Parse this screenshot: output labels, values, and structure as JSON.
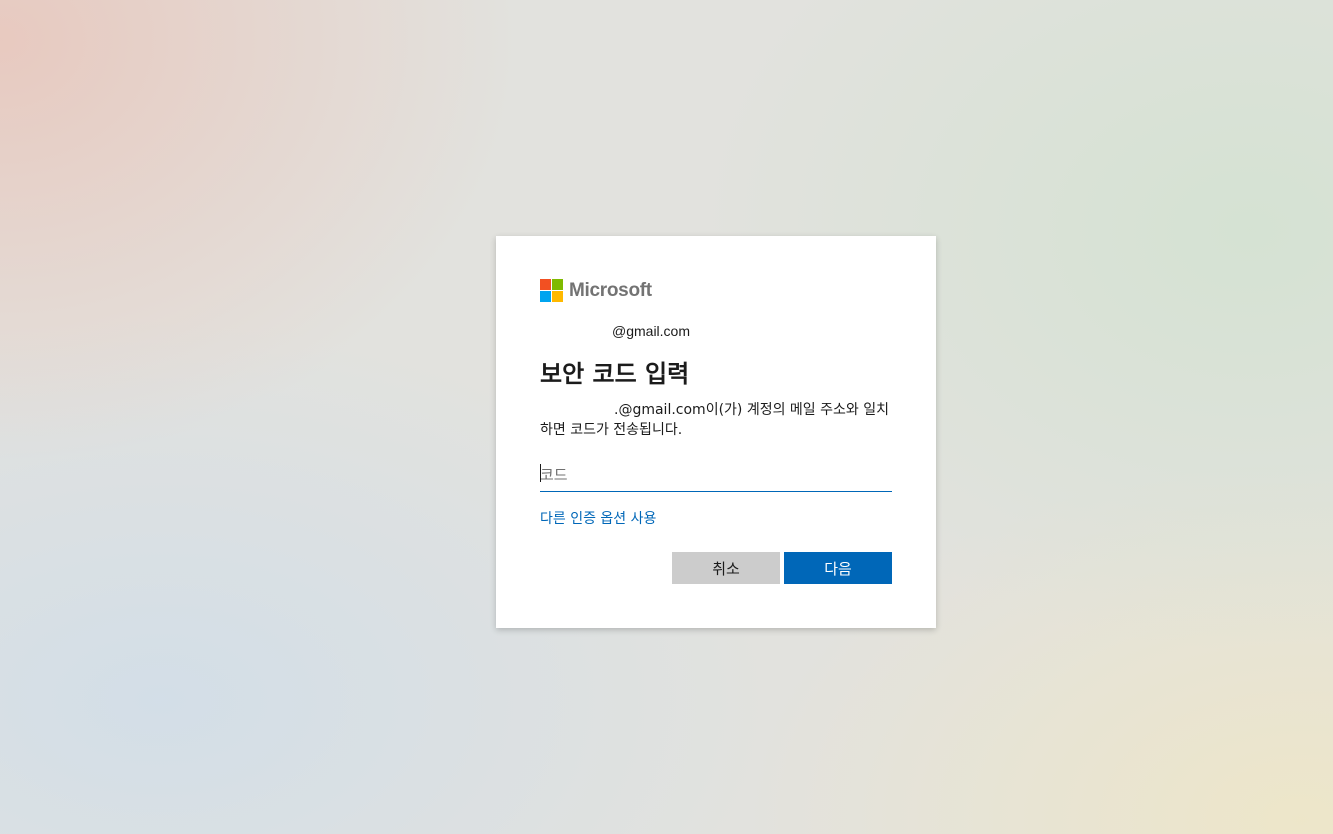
{
  "brand": {
    "name": "Microsoft",
    "logo_colors": [
      "#f25022",
      "#7fba00",
      "#00a4ef",
      "#ffb900"
    ]
  },
  "identity": {
    "email_visible": "@gmail.com"
  },
  "page": {
    "title": "보안 코드 입력",
    "description_email_visible": ".@gmail.com",
    "description_rest": "이(가) 계정의 메일 주소와 일치하면 코드가 전송됩니다."
  },
  "code_field": {
    "placeholder": "코드",
    "value": ""
  },
  "links": {
    "other_options": "다른 인증 옵션 사용"
  },
  "buttons": {
    "cancel": "취소",
    "next": "다음"
  },
  "colors": {
    "accent": "#0067b8",
    "cancel_bg": "#cccccc"
  }
}
